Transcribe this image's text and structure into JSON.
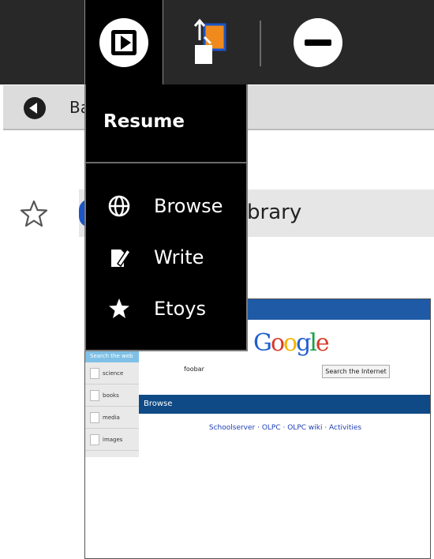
{
  "toolbar": {
    "icons": [
      "activity-play-icon",
      "journal-copy-icon",
      "stop-icon"
    ]
  },
  "navbar": {
    "back_label": "Ba"
  },
  "urlbar": {
    "text": "brary"
  },
  "menu": {
    "title": "Resume",
    "items": [
      {
        "label": "Browse",
        "icon": "globe-icon"
      },
      {
        "label": "Write",
        "icon": "write-icon"
      },
      {
        "label": "Etoys",
        "icon": "star-icon"
      }
    ]
  },
  "thumbnail": {
    "logo": "Google",
    "search_value": "foobar",
    "search_button": "Search the Internet",
    "side_search": "Search the web",
    "side_items": [
      "science",
      "books",
      "media",
      "images"
    ],
    "band_label": "Browse",
    "links": "Schoolserver · OLPC · OLPC wiki · Activities"
  },
  "colors": {
    "toolbar_bg": "#282828",
    "menu_bg": "#000000",
    "navbar_bg": "#dcdcdc",
    "accent_blue": "#1b55c8"
  }
}
